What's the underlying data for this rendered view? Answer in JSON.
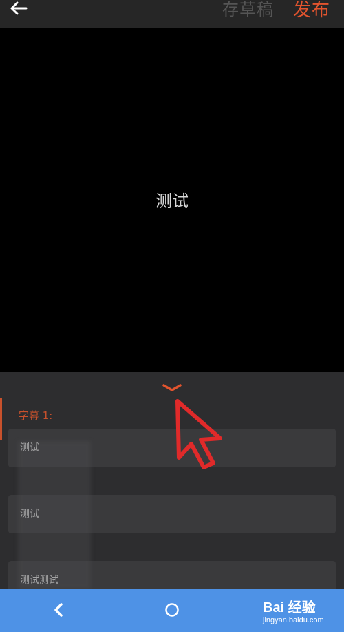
{
  "header": {
    "draft_label": "存草稿",
    "publish_label": "发布",
    "back_icon": "arrow-left-icon"
  },
  "preview": {
    "caption_text": "测试"
  },
  "subtitles": {
    "collapse_icon": "chevron-down-icon",
    "header_label": "字幕 1:",
    "items": [
      {
        "text": "测试"
      },
      {
        "text": "测试"
      },
      {
        "text": "测试测试"
      }
    ]
  },
  "navbar": {
    "back_icon": "chevron-left-icon",
    "home_icon": "circle-home-icon",
    "watermark_top": "Bai 经验",
    "watermark_bottom": "jingyan.baidu.com"
  },
  "colors": {
    "accent": "#e2542e",
    "annotation": "#e02a2a",
    "navbar": "#4e92e6"
  }
}
